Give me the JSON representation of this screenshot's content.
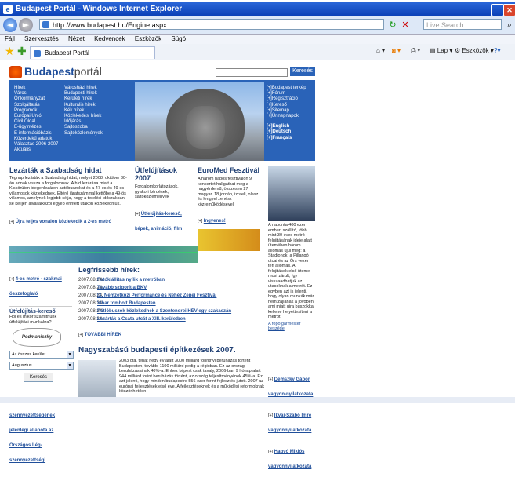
{
  "window": {
    "title": "Budapest Portál - Windows Internet Explorer"
  },
  "address": {
    "url": "http://www.budapest.hu/Engine.aspx",
    "search_placeholder": "Live Search"
  },
  "menu": [
    "Fájl",
    "Szerkesztés",
    "Nézet",
    "Kedvencek",
    "Eszközök",
    "Súgó"
  ],
  "tab": {
    "label": "Budapest Portál"
  },
  "toolbar": {
    "lap": "Lap",
    "eszkozok": "Eszközök"
  },
  "site": {
    "logo_bold": "Budapest",
    "logo_rest": "portál",
    "search_button": "Keresés",
    "nav_col1": [
      "Hírek",
      "Város",
      "Önkormányzat",
      "Szolgáltatás",
      "Programok",
      "Európai Unió",
      "Civil Oldal",
      "E-ügyintézés",
      "E-információbázis - Közérdekű adatok",
      "Választás 2006-2007",
      "Aktuális"
    ],
    "nav_col2": [
      "Városházi hírek",
      "Budapesti hírek",
      "Kerületi hírek",
      "Kulturális hírek",
      "Kék hírek",
      "Közlekedési hírek",
      "Időjárás",
      "Sajtószoba",
      "Sajtóközlemények"
    ],
    "right_nav": [
      "[+]Budapest térkép",
      "[+]Fórum",
      "[+]Regisztráció",
      "[+]Kereső",
      "[+]Sitemap",
      "[+]Ünnepnapok"
    ],
    "languages": [
      "[+]English",
      "[+]Deutsch",
      "[+]Français"
    ]
  },
  "articles": {
    "a1": {
      "title": "Lezárták a Szabadság hidat",
      "text": "Tegnap lezárták a Szabadság hidat, melyet 2008. október 30-án adnak vissza a forgalomnak. A híd lezárása miatt a Kiskörúton idegenlezáron autóbuszokat és a 47-es és 49-es villamosok közlekednek. Eltérő járatszámmal kettőbe a 49-ös villamos, amelynek legjobb célja, hogy a terelési időszakban se kelljen alvállalkozói egyéb érintett utakon közlekedniük.",
      "link": "Újra teljes vonalon közlekedik a 2-es metró"
    },
    "a2": {
      "title": "Útfelújítások 2007",
      "text": "Forgalomkorlátozások, gyakori kérdések, sajtóközlemények",
      "link": "Útfelújítás-kereső, képek, animáció, film"
    },
    "a3": {
      "title": "EuroMed Fesztivál",
      "text": "A három napos fesztiválon 9 koncertet hallgathat meg a nagyérdemű, összesen 27 magyar, 18 jordán, izraeli, olasz és lengyel zenész közreműködésével.",
      "link": "Ingyenes!"
    },
    "side": {
      "text": "A naponta 400 ezer embert szállító, több mint 30 éves metró felújításának ideje alatt ütemében három állomás újul meg: a Stadionok, a Pillangó utcai és az Örs vezér téri állomás. A felújítások első üteme most zárult, így visszaadhatjuk az utasoknak a metrót. Ez egyben azt is jelenti, hogy olyan munkák már nem zajlanak a jövőben, ami miatt újra buszokkal kellene helyettesíteni a metrót.",
      "link": "A főpolgármester beszéde"
    }
  },
  "metro": {
    "label": "4-es metró - szakmai összefoglaló"
  },
  "search": {
    "title": "Útfelújítás-kereső",
    "text": "Hol és mikor számíthunk útfelújítási munkákra?",
    "logo": "Podmaniczky Program",
    "district": "Az összes kerület",
    "month": "Augusztus",
    "button": "Keresés"
  },
  "left_link": "Budapest lég-szennyezettségének jelenlegi állapota az Országos Lég-szennyezettségi",
  "news": {
    "title": "Legfrissebb hírek:",
    "items": [
      {
        "date": "2007.08.24.",
        "title": "Fotókiállítás nyílik a metróban"
      },
      {
        "date": "2007.08.24.",
        "title": "Tovább szigorít a BKV"
      },
      {
        "date": "2007.08.24.",
        "title": "IX. Nemzetközi Performance és Nehéz Zenei Fesztivál"
      },
      {
        "date": "2007.08.24.",
        "title": "Vihar tombolt Budapesten"
      },
      {
        "date": "2007.08.24.",
        "title": "Pótlóbuszok közlekednek a Szentendrei HÉV egy szakaszán"
      },
      {
        "date": "2007.08.24.",
        "title": "Lezárták a Csata utcát a XIII. kerületben"
      }
    ],
    "more": "TOVÁBBI HÍREK"
  },
  "bigstory": {
    "title": "Nagyszabású budapesti építkezések 2007.",
    "text": "2003 óta, tehát négy év alatt 3000 milliárd forintnyi beruházás történt Budapesten, további 1100 milliárd pedig a régióban. Ez az ország beruházásainak 40%-a. Ehhez képest csak tavaly, 2006-ban 9 hónap alatt 944 milliárd forint beruházás történt, az ország teljesítményének 45%-a. Ez azt jelenti, hogy minden budapestre 556 ezer forint fejlesztés jutott. 2007 az európai fejlesztések első éve. A fejlesztéseknek és a működési reformoknak köszönhetően"
  },
  "side_links": [
    "Demszky Gábor vagyon-nyilatkozata",
    "Ikvai-Szabó Imre vagyonnyilatkozata",
    "Hagyó Miklós vagyonnyilatkozata"
  ]
}
